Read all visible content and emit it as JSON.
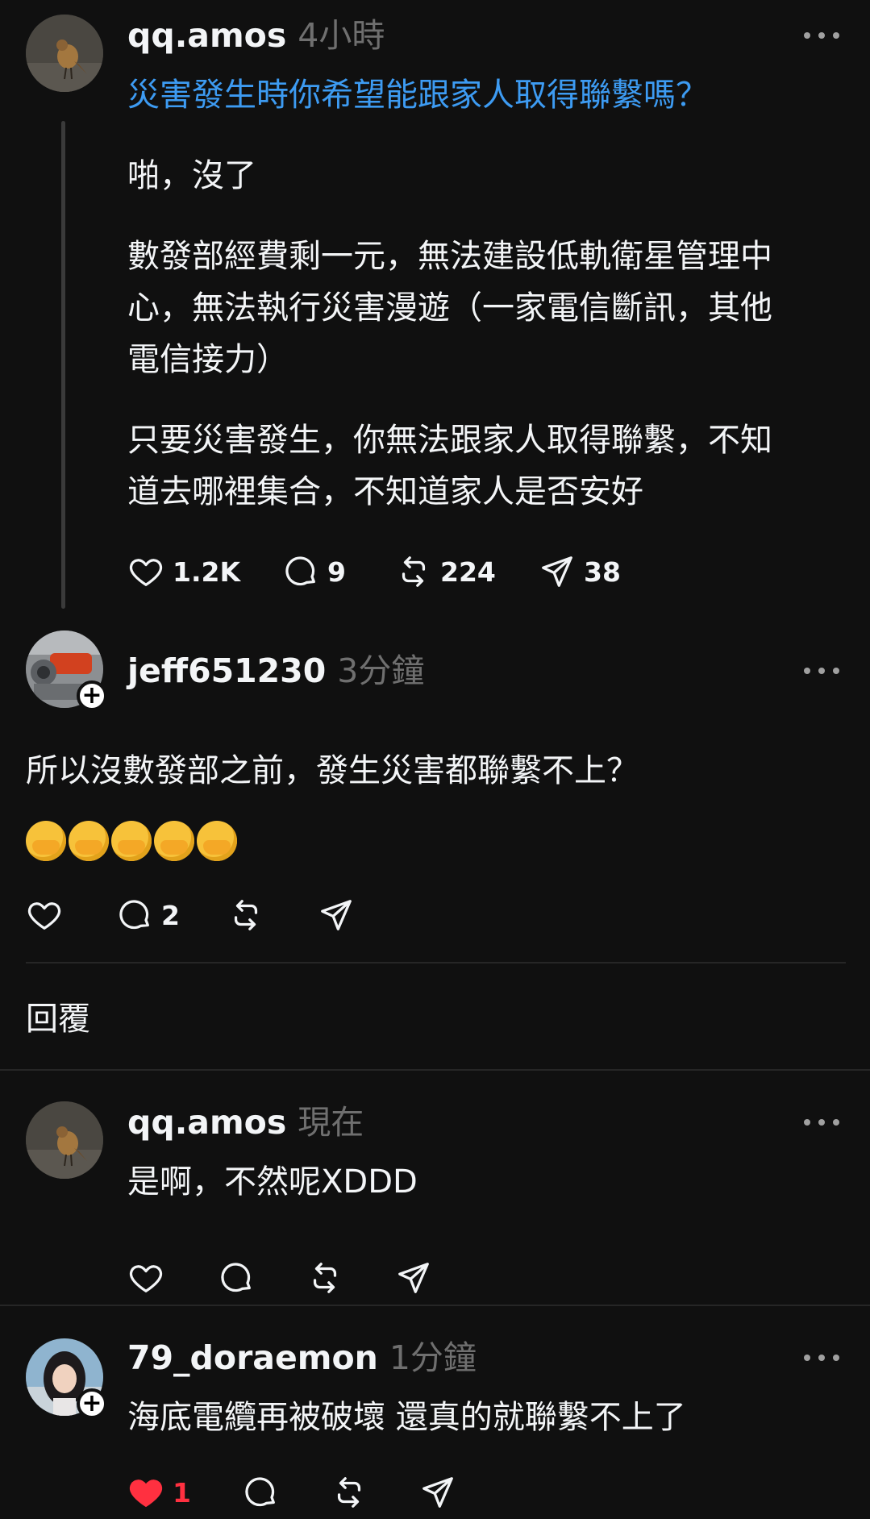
{
  "original_post": {
    "username": "qq.amos",
    "time": "4小時",
    "topic": "災害發生時你希望能跟家人取得聯繫嗎？",
    "paragraphs": [
      [
        "啪，沒了"
      ],
      [
        "數發部經費剩一元，無法建設低軌衛星管理中",
        "心，無法執行災害漫遊（一家電信斷訊，其他",
        "電信接力）"
      ],
      [
        "只要災害發生，你無法跟家人取得聯繫，不知",
        "道去哪裡集合，不知道家人是否安好"
      ]
    ],
    "likes": "1.2K",
    "comments": "9",
    "reposts": "224",
    "shares": "38"
  },
  "reply1": {
    "username": "jeff651230",
    "time": "3分鐘",
    "text": "所以沒數發部之前，發生災害都聯繫不上？",
    "emoji_count": 5,
    "comments": "2"
  },
  "reply_label": "回覆",
  "reply2": {
    "username": "qq.amos",
    "time": "現在",
    "text": "是啊，不然呢XDDD"
  },
  "reply3": {
    "username": "79_doraemon",
    "time": "1分鐘",
    "text": "海底電纜再被破壞 還真的就聯繫不上了",
    "likes": "1"
  },
  "colors": {
    "background": "#101010",
    "link": "#3d9bf2",
    "liked": "#ff3040",
    "muted": "#6f6f6f"
  },
  "icons": [
    "heart-icon",
    "comment-icon",
    "repost-icon",
    "share-icon",
    "more-icon",
    "follow-plus-icon"
  ]
}
